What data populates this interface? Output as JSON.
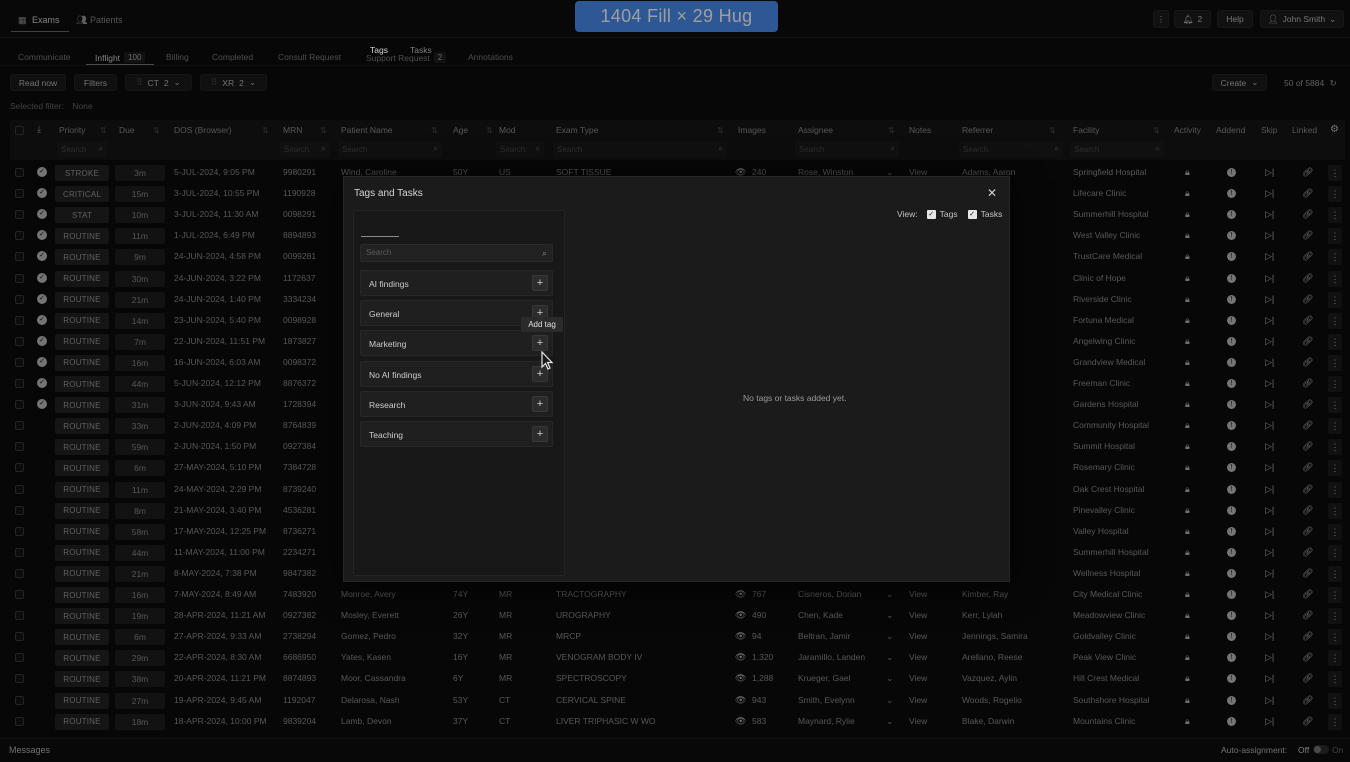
{
  "topbar": {
    "tabs": [
      {
        "label": "Exams",
        "icon": "table-icon"
      },
      {
        "label": "Patients",
        "icon": "users-icon"
      }
    ],
    "figma_label": "1404 Fill × 29 Hug",
    "more_icon": "⋮",
    "notifications": "2",
    "help": "Help",
    "user": "John Smith"
  },
  "subtabs": [
    {
      "label": "Communicate"
    },
    {
      "label": "Inflight",
      "count": "100"
    },
    {
      "label": "Billing"
    },
    {
      "label": "Completed"
    },
    {
      "label": "Consult Request"
    },
    {
      "label": "Support Request",
      "count": "2"
    },
    {
      "label": "Annotations"
    }
  ],
  "toolbar": {
    "read_now": "Read now",
    "filters": "Filters",
    "chip1": {
      "label": "CT",
      "count": "2"
    },
    "chip2": {
      "label": "XR",
      "count": "2"
    },
    "create": "Create",
    "range": "50 of 5884",
    "selected_filter_label": "Selected filter:",
    "selected_filter_value": "None"
  },
  "columns": {
    "priority": "Priority",
    "due": "Due",
    "dos": "DOS (Browser)",
    "mrn": "MRN",
    "patient": "Patient Name",
    "age": "Age",
    "mod": "Mod",
    "exam": "Exam Type",
    "images": "Images",
    "assignee": "Assignee",
    "notes": "Notes",
    "referrer": "Referrer",
    "facility": "Facility",
    "activity": "Activity",
    "addend": "Addend",
    "skip": "Skip",
    "linked": "Linked",
    "search_placeholder": "Search"
  },
  "rows": [
    {
      "done": true,
      "priority": "STROKE",
      "due": "3m",
      "dos": "5-JUL-2024, 9:05 PM",
      "mrn": "9980291",
      "patient": "Wind, Caroline",
      "age": "50Y",
      "mod": "US",
      "exam": "SOFT TISSUE",
      "images": "240",
      "assignee": "Rose, Winston",
      "notes": "View",
      "referrer": "Adams, Aaron",
      "facility": "Springfield Hospital"
    },
    {
      "done": true,
      "priority": "CRITICAL",
      "due": "15m",
      "dos": "3-JUL-2024, 10:55 PM",
      "mrn": "1190928",
      "patient": "",
      "age": "",
      "mod": "",
      "exam": "",
      "images": "",
      "assignee": "",
      "notes": "",
      "referrer": "",
      "facility": "Lifecare Clinic"
    },
    {
      "done": true,
      "priority": "STAT",
      "due": "10m",
      "dos": "3-JUL-2024, 11:30 AM",
      "mrn": "0098291",
      "patient": "",
      "age": "",
      "mod": "",
      "exam": "",
      "images": "",
      "assignee": "",
      "notes": "",
      "referrer": "ex",
      "facility": "Summerhill Hospital"
    },
    {
      "done": true,
      "priority": "ROUTINE",
      "due": "11m",
      "dos": "1-JUL-2024, 6:49 PM",
      "mrn": "8894893",
      "patient": "",
      "age": "",
      "mod": "",
      "exam": "",
      "images": "",
      "assignee": "",
      "notes": "",
      "referrer": "ann",
      "facility": "West Valley Clinic"
    },
    {
      "done": true,
      "priority": "ROUTINE",
      "due": "9m",
      "dos": "24-JUN-2024, 4:58 PM",
      "mrn": "0099281",
      "patient": "",
      "age": "",
      "mod": "",
      "exam": "",
      "images": "",
      "assignee": "",
      "notes": "",
      "referrer": "alani",
      "facility": "TrustCare Medical"
    },
    {
      "done": true,
      "priority": "ROUTINE",
      "due": "30m",
      "dos": "24-JUN-2024, 3:22 PM",
      "mrn": "1172637",
      "patient": "",
      "age": "",
      "mod": "",
      "exam": "",
      "images": "",
      "assignee": "",
      "notes": "",
      "referrer": "ana",
      "facility": "Clinic of Hope"
    },
    {
      "done": true,
      "priority": "ROUTINE",
      "due": "21m",
      "dos": "24-JUN-2024, 1:40 PM",
      "mrn": "3334234",
      "patient": "",
      "age": "",
      "mod": "",
      "exam": "",
      "images": "",
      "assignee": "",
      "notes": "",
      "referrer": "ate",
      "facility": "Riverside Clinic"
    },
    {
      "done": true,
      "priority": "ROUTINE",
      "due": "14m",
      "dos": "23-JUN-2024, 5:40 PM",
      "mrn": "0098928",
      "patient": "",
      "age": "",
      "mod": "",
      "exam": "",
      "images": "",
      "assignee": "",
      "notes": "",
      "referrer": "",
      "facility": "Fortuna Medical"
    },
    {
      "done": true,
      "priority": "ROUTINE",
      "due": "7m",
      "dos": "22-JUN-2024, 11:51 PM",
      "mrn": "1873827",
      "patient": "",
      "age": "",
      "mod": "",
      "exam": "",
      "images": "",
      "assignee": "",
      "notes": "",
      "referrer": "e",
      "facility": "Angelwing Clinic"
    },
    {
      "done": true,
      "priority": "ROUTINE",
      "due": "16m",
      "dos": "16-JUN-2024, 6:03 AM",
      "mrn": "0098372",
      "patient": "",
      "age": "",
      "mod": "",
      "exam": "",
      "images": "",
      "assignee": "",
      "notes": "",
      "referrer": "",
      "facility": "Grandview Medical"
    },
    {
      "done": true,
      "priority": "ROUTINE",
      "due": "44m",
      "dos": "5-JUN-2024, 12:12 PM",
      "mrn": "8876372",
      "patient": "",
      "age": "",
      "mod": "",
      "exam": "",
      "images": "",
      "assignee": "",
      "notes": "",
      "referrer": "emis",
      "facility": "Freeman Clinic"
    },
    {
      "done": true,
      "priority": "ROUTINE",
      "due": "31m",
      "dos": "3-JUN-2024, 9:43 AM",
      "mrn": "1728394",
      "patient": "",
      "age": "",
      "mod": "",
      "exam": "",
      "images": "",
      "assignee": "",
      "notes": "",
      "referrer": "na",
      "facility": "Gardens Hospital"
    },
    {
      "done": false,
      "priority": "ROUTINE",
      "due": "33m",
      "dos": "2-JUN-2024, 4:09 PM",
      "mrn": "8764839",
      "patient": "",
      "age": "",
      "mod": "",
      "exam": "",
      "images": "",
      "assignee": "",
      "notes": "",
      "referrer": "",
      "facility": "Community Hospital"
    },
    {
      "done": false,
      "priority": "ROUTINE",
      "due": "59m",
      "dos": "2-JUN-2024, 1:50 PM",
      "mrn": "0927384",
      "patient": "",
      "age": "",
      "mod": "",
      "exam": "",
      "images": "",
      "assignee": "",
      "notes": "",
      "referrer": "ensen",
      "facility": "Summit Hospital"
    },
    {
      "done": false,
      "priority": "ROUTINE",
      "due": "6m",
      "dos": "27-MAY-2024, 5:10 PM",
      "mrn": "7384728",
      "patient": "",
      "age": "",
      "mod": "",
      "exam": "",
      "images": "",
      "assignee": "",
      "notes": "",
      "referrer": "n",
      "facility": "Rosemary Clinic"
    },
    {
      "done": false,
      "priority": "ROUTINE",
      "due": "11m",
      "dos": "24-MAY-2024, 2:29 PM",
      "mrn": "8739240",
      "patient": "",
      "age": "",
      "mod": "",
      "exam": "",
      "images": "",
      "assignee": "",
      "notes": "",
      "referrer": "ton",
      "facility": "Oak Crest Hospital"
    },
    {
      "done": false,
      "priority": "ROUTINE",
      "due": "8m",
      "dos": "21-MAY-2024, 3:40 PM",
      "mrn": "4536281",
      "patient": "",
      "age": "",
      "mod": "",
      "exam": "",
      "images": "",
      "assignee": "",
      "notes": "",
      "referrer": "elio",
      "facility": "Pinevalley Clinic"
    },
    {
      "done": false,
      "priority": "ROUTINE",
      "due": "58m",
      "dos": "17-MAY-2024, 12:25 PM",
      "mrn": "8736271",
      "patient": "",
      "age": "",
      "mod": "",
      "exam": "",
      "images": "",
      "assignee": "",
      "notes": "",
      "referrer": "Joel",
      "facility": "Valley Hospital"
    },
    {
      "done": false,
      "priority": "ROUTINE",
      "due": "44m",
      "dos": "11-MAY-2024, 11:00 PM",
      "mrn": "2234271",
      "patient": "",
      "age": "",
      "mod": "",
      "exam": "",
      "images": "",
      "assignee": "",
      "notes": "",
      "referrer": "",
      "facility": "Summerhill Hospital"
    },
    {
      "done": false,
      "priority": "ROUTINE",
      "due": "21m",
      "dos": "8-MAY-2024, 7:38 PM",
      "mrn": "9847382",
      "patient": "",
      "age": "",
      "mod": "",
      "exam": "",
      "images": "",
      "assignee": "",
      "notes": "",
      "referrer": "",
      "facility": "Wellness Hospital"
    },
    {
      "done": false,
      "priority": "ROUTINE",
      "due": "16m",
      "dos": "7-MAY-2024, 8:49 AM",
      "mrn": "7483920",
      "patient": "Monroe, Avery",
      "age": "74Y",
      "mod": "MR",
      "exam": "TRACTOGRAPHY",
      "images": "767",
      "assignee": "Cisneros, Dorian",
      "notes": "View",
      "referrer": "Kimber, Ray",
      "facility": "City Medical Clinic"
    },
    {
      "done": false,
      "priority": "ROUTINE",
      "due": "19m",
      "dos": "28-APR-2024, 11:21 AM",
      "mrn": "0927382",
      "patient": "Mosley, Everett",
      "age": "26Y",
      "mod": "MR",
      "exam": "UROGRAPHY",
      "images": "490",
      "assignee": "Chen, Kade",
      "notes": "View",
      "referrer": "Kerr, Lylah",
      "facility": "Meadowview Clinic"
    },
    {
      "done": false,
      "priority": "ROUTINE",
      "due": "6m",
      "dos": "27-APR-2024, 9:33 AM",
      "mrn": "2738294",
      "patient": "Gomez, Pedro",
      "age": "32Y",
      "mod": "MR",
      "exam": "MRCP",
      "images": "94",
      "assignee": "Beltran, Jamir",
      "notes": "View",
      "referrer": "Jennings, Samira",
      "facility": "Goldvalley Clinic"
    },
    {
      "done": false,
      "priority": "ROUTINE",
      "due": "29m",
      "dos": "22-APR-2024, 8:30 AM",
      "mrn": "6686950",
      "patient": "Yates, Kasen",
      "age": "16Y",
      "mod": "MR",
      "exam": "VENOGRAM BODY IV",
      "images": "1,320",
      "assignee": "Jaramillo, Landen",
      "notes": "View",
      "referrer": "Arellano, Reese",
      "facility": "Peak View Clinic"
    },
    {
      "done": false,
      "priority": "ROUTINE",
      "due": "38m",
      "dos": "20-APR-2024, 11:21 PM",
      "mrn": "8874893",
      "patient": "Moor, Cassandra",
      "age": "6Y",
      "mod": "MR",
      "exam": "SPECTROSCOPY",
      "images": "1,288",
      "assignee": "Krueger, Gael",
      "notes": "View",
      "referrer": "Vazquez, Aylin",
      "facility": "Hill Crest Medical"
    },
    {
      "done": false,
      "priority": "ROUTINE",
      "due": "27m",
      "dos": "19-APR-2024, 9:45 AM",
      "mrn": "1192047",
      "patient": "Delarosa, Nash",
      "age": "53Y",
      "mod": "CT",
      "exam": "CERVICAL SPINE",
      "images": "943",
      "assignee": "Smith, Evelynn",
      "notes": "View",
      "referrer": "Woods, Rogelio",
      "facility": "Southshore Hospital"
    },
    {
      "done": false,
      "priority": "ROUTINE",
      "due": "18m",
      "dos": "18-APR-2024, 10:00 PM",
      "mrn": "9839204",
      "patient": "Lamb, Devon",
      "age": "37Y",
      "mod": "CT",
      "exam": "LIVER TRIPHASIC W WO",
      "images": "583",
      "assignee": "Maynard, Rylie",
      "notes": "View",
      "referrer": "Blake, Darwin",
      "facility": "Mountains Clinic"
    }
  ],
  "footer": {
    "messages": "Messages",
    "auto_label": "Auto-assignment:",
    "auto_off": "Off",
    "auto_on": "On"
  },
  "modal": {
    "title": "Tags and Tasks",
    "tabs": [
      "Tags",
      "Tasks"
    ],
    "search_placeholder": "Search",
    "view_label": "View:",
    "view_tags": "Tags",
    "view_tasks": "Tasks",
    "tags": [
      "AI findings",
      "General",
      "Marketing",
      "No AI findings",
      "Research",
      "Teaching"
    ],
    "tooltip": "Add tag",
    "empty": "No tags or tasks added yet."
  }
}
